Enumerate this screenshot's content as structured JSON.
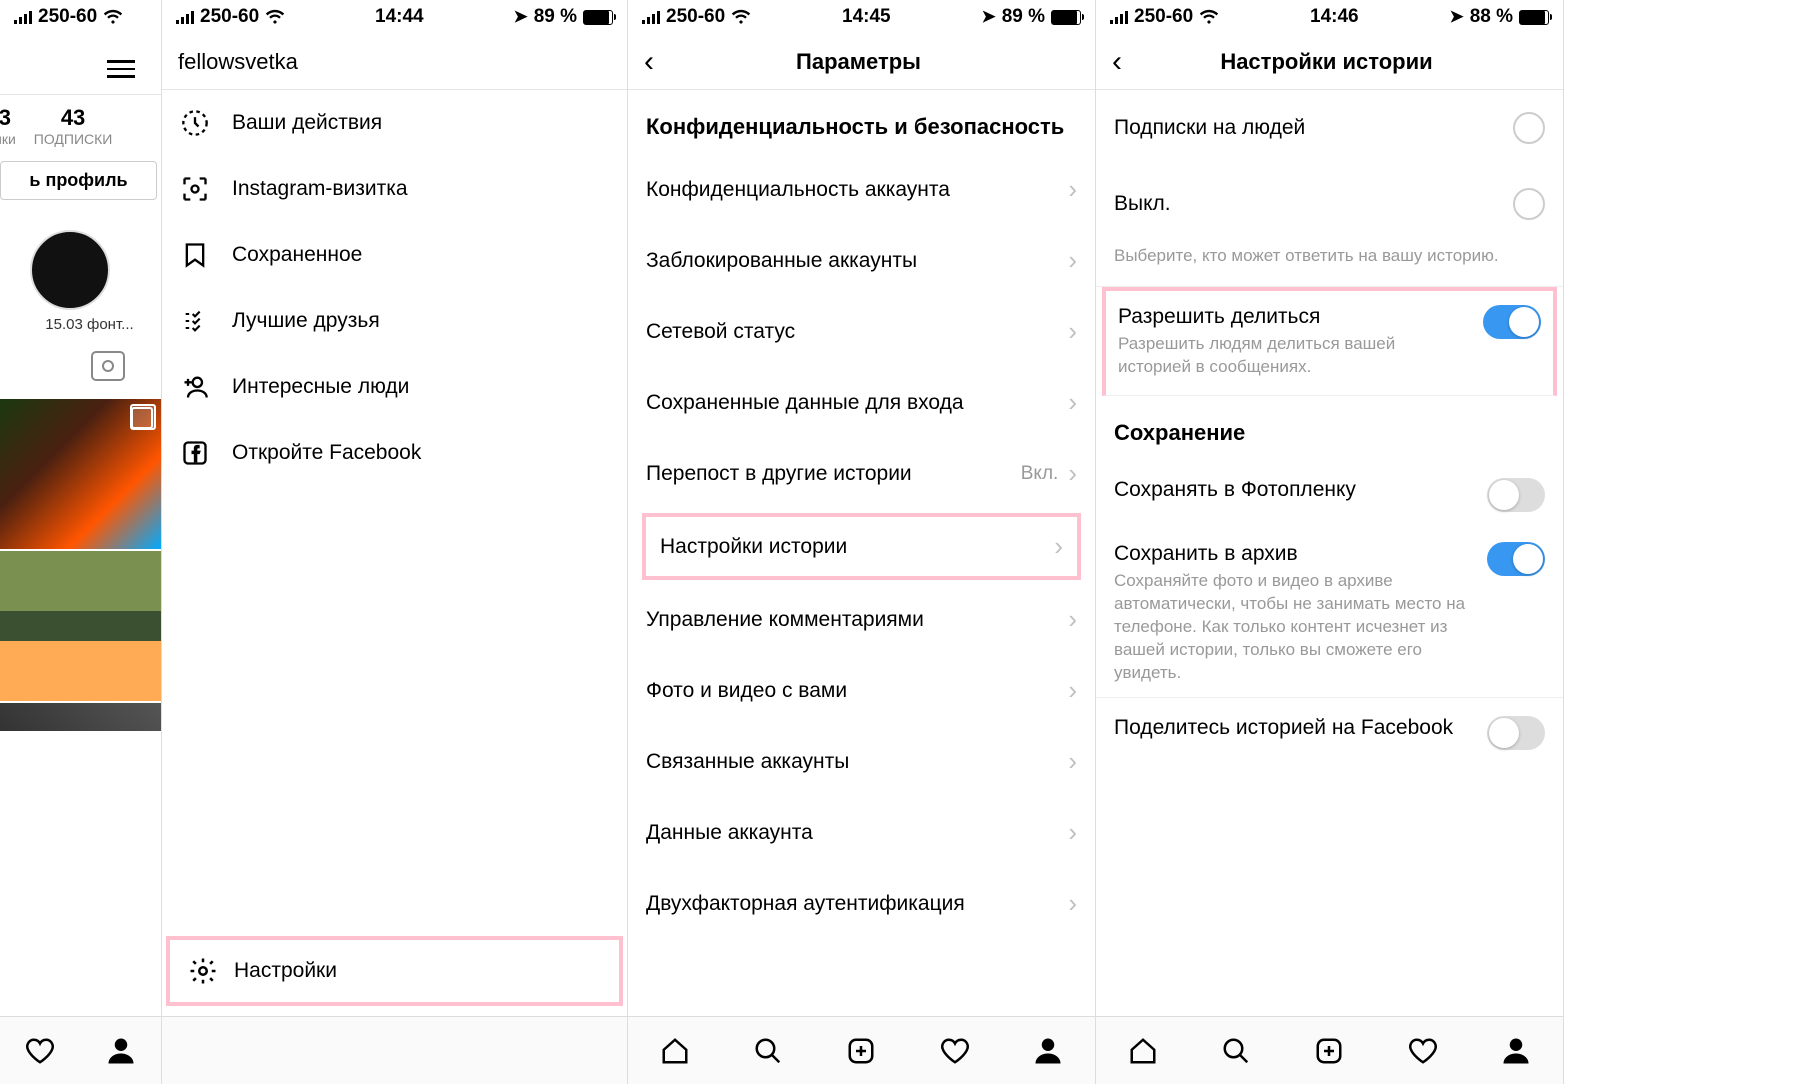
{
  "left_partial": {
    "status": {
      "carrier": "250-60"
    },
    "stats": {
      "num1": "3",
      "label1": "ики",
      "num2": "43",
      "label2": "ПОДПИСКИ"
    },
    "edit_btn": "ь профиль",
    "highlight_label": "15.03 фонт..."
  },
  "screen1": {
    "status": {
      "carrier": "250-60",
      "time": "14:44",
      "battery_pct": "89 %"
    },
    "username": "fellowsvetka",
    "menu": [
      "Ваши действия",
      "Instagram-визитка",
      "Сохраненное",
      "Лучшие друзья",
      "Интересные люди",
      "Откройте Facebook"
    ],
    "settings_label": "Настройки"
  },
  "screen2": {
    "status": {
      "carrier": "250-60",
      "time": "14:45",
      "battery_pct": "89 %"
    },
    "title": "Параметры",
    "section": "Конфиденциальность и безопасность",
    "rows": [
      "Конфиденциальность аккаунта",
      "Заблокированные аккаунты",
      "Сетевой статус",
      "Сохраненные данные для входа",
      "Перепост в другие истории",
      "Настройки истории",
      "Управление комментариями",
      "Фото и видео с вами",
      "Связанные аккаунты",
      "Данные аккаунта",
      "Двухфакторная аутентификация"
    ],
    "repost_value": "Вкл."
  },
  "screen3": {
    "status": {
      "carrier": "250-60",
      "time": "14:46",
      "battery_pct": "88 %"
    },
    "title": "Настройки истории",
    "radio1": "Подписки на людей",
    "radio2": "Выкл.",
    "hint1": "Выберите, кто может ответить на вашу историю.",
    "allow_share_title": "Разрешить делиться",
    "allow_share_desc": "Разрешить людям делиться вашей историей в сообщениях.",
    "saving_header": "Сохранение",
    "save_camera": "Сохранять в Фотопленку",
    "save_archive_title": "Сохранить в архив",
    "save_archive_desc": "Сохраняйте фото и видео в архиве автоматически, чтобы не занимать место на телефоне. Как только контент исчезнет из вашей истории, только вы сможете его увидеть.",
    "share_fb": "Поделитесь историей на Facebook"
  }
}
